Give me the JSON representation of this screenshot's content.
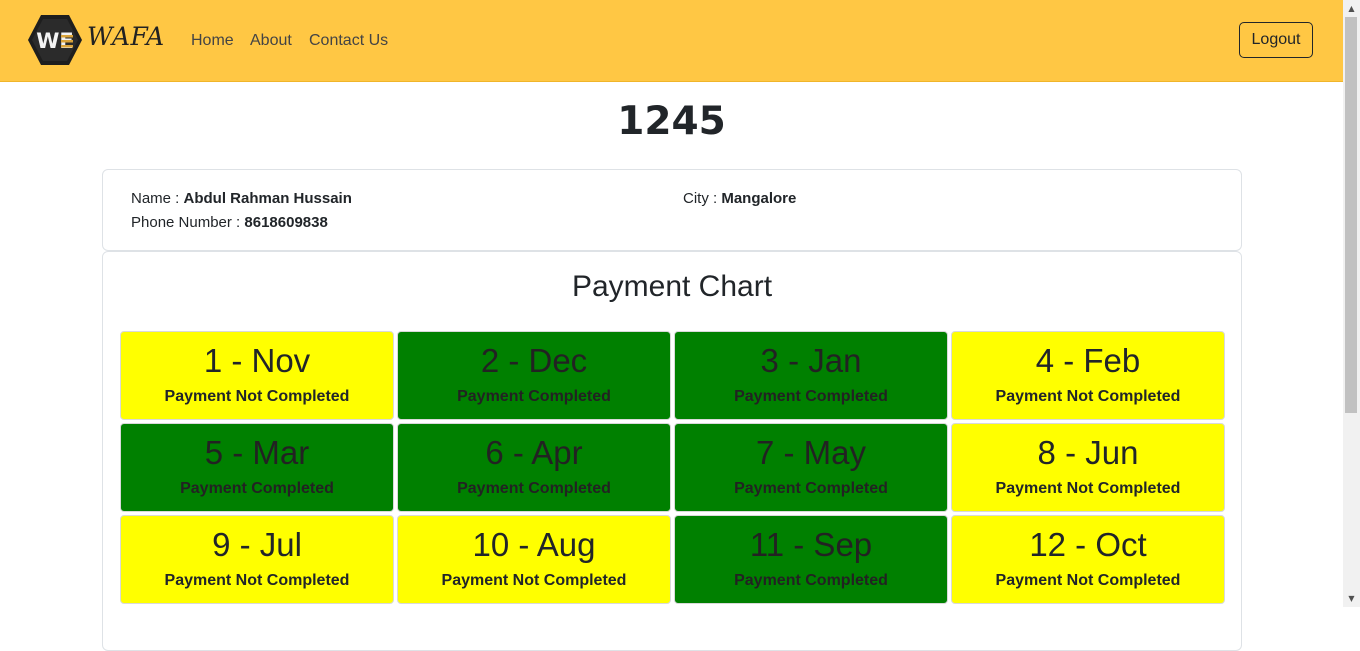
{
  "brand": {
    "name": "WAFA",
    "logo_text": "WE"
  },
  "nav": {
    "items": [
      "Home",
      "About",
      "Contact Us"
    ],
    "logout_label": "Logout"
  },
  "page": {
    "id_heading": "1245"
  },
  "member": {
    "name_label": "Name : ",
    "name": "Abdul Rahman Hussain",
    "phone_label": "Phone Number : ",
    "phone": "8618609838",
    "city_label": "City : ",
    "city": "Mangalore"
  },
  "chart": {
    "title": "Payment Chart",
    "cells": [
      {
        "label": "1 - Nov",
        "status": "Payment Not Completed",
        "state": "pending"
      },
      {
        "label": "2 - Dec",
        "status": "Payment Completed",
        "state": "done"
      },
      {
        "label": "3 - Jan",
        "status": "Payment Completed",
        "state": "done"
      },
      {
        "label": "4 - Feb",
        "status": "Payment Not Completed",
        "state": "pending"
      },
      {
        "label": "5 - Mar",
        "status": "Payment Completed",
        "state": "done"
      },
      {
        "label": "6 - Apr",
        "status": "Payment Completed",
        "state": "done"
      },
      {
        "label": "7 - May",
        "status": "Payment Completed",
        "state": "done"
      },
      {
        "label": "8 - Jun",
        "status": "Payment Not Completed",
        "state": "pending"
      },
      {
        "label": "9 - Jul",
        "status": "Payment Not Completed",
        "state": "pending"
      },
      {
        "label": "10 - Aug",
        "status": "Payment Not Completed",
        "state": "pending"
      },
      {
        "label": "11 - Sep",
        "status": "Payment Completed",
        "state": "done"
      },
      {
        "label": "12 - Oct",
        "status": "Payment Not Completed",
        "state": "pending"
      }
    ]
  },
  "colors": {
    "navbar": "#ffc744",
    "completed": "#008000",
    "not_completed": "#ffff00"
  }
}
